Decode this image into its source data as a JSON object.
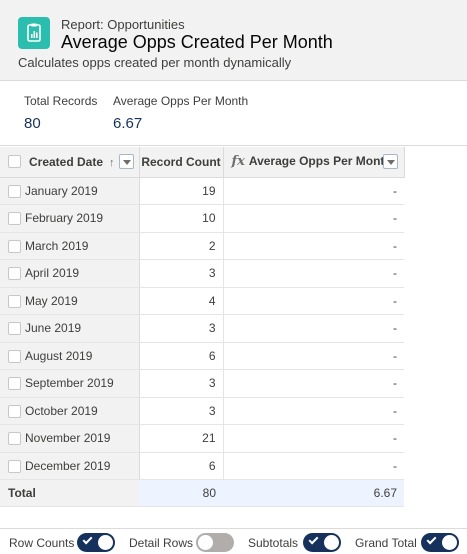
{
  "header": {
    "report_type": "Report: Opportunities",
    "title": "Average Opps Created Per Month",
    "description": "Calculates opps created per month dynamically",
    "icon": "report-icon",
    "icon_color": "#2bbdad"
  },
  "summary": {
    "total_records_label": "Total Records",
    "total_records_value": "80",
    "avg_label": "Average Opps Per Month",
    "avg_value": "6.67"
  },
  "table": {
    "columns": {
      "date": "Created Date",
      "count": "Record Count",
      "avg": "Average Opps Per Month",
      "sort_indicator": "↑",
      "formula_icon": "fx"
    },
    "rows": [
      {
        "date": "January 2019",
        "count": "19",
        "avg": "-"
      },
      {
        "date": "February 2019",
        "count": "10",
        "avg": "-"
      },
      {
        "date": "March 2019",
        "count": "2",
        "avg": "-"
      },
      {
        "date": "April 2019",
        "count": "3",
        "avg": "-"
      },
      {
        "date": "May 2019",
        "count": "4",
        "avg": "-"
      },
      {
        "date": "June 2019",
        "count": "3",
        "avg": "-"
      },
      {
        "date": "August 2019",
        "count": "6",
        "avg": "-"
      },
      {
        "date": "September 2019",
        "count": "3",
        "avg": "-"
      },
      {
        "date": "October 2019",
        "count": "3",
        "avg": "-"
      },
      {
        "date": "November 2019",
        "count": "21",
        "avg": "-"
      },
      {
        "date": "December 2019",
        "count": "6",
        "avg": "-"
      }
    ],
    "total": {
      "label": "Total",
      "count": "80",
      "avg": "6.67"
    }
  },
  "footer": {
    "row_counts": {
      "label": "Row Counts",
      "on": true
    },
    "detail_rows": {
      "label": "Detail Rows",
      "on": false
    },
    "subtotals": {
      "label": "Subtotals",
      "on": true
    },
    "grand_total": {
      "label": "Grand Total",
      "on": true
    },
    "toggle_on_color": "#16325c"
  }
}
